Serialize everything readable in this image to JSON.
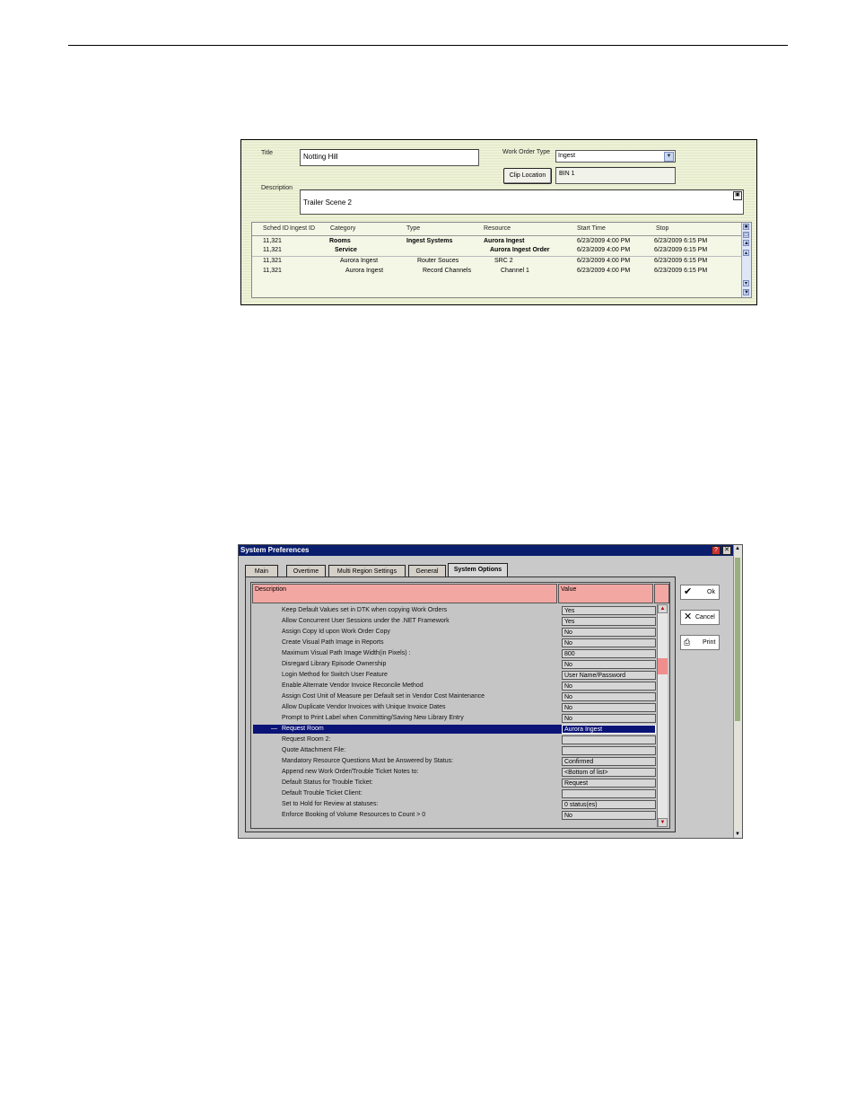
{
  "work_order": {
    "title_label": "Title",
    "title_value": "Notting Hill",
    "work_order_type_label": "Work Order Type",
    "work_order_type_value": "Ingest",
    "clip_location_button": "Clip Location",
    "clip_location_value": "BIN 1",
    "description_label": "Description",
    "description_value": "Trailer Scene 2",
    "columns": [
      "Sched ID",
      "Ingest ID",
      "Category",
      "Type",
      "Resource",
      "Start Time",
      "Stop"
    ],
    "rows": [
      {
        "sched_id": "11,321",
        "category": "Rooms",
        "type": "Ingest Systems",
        "resource": "Aurora Ingest",
        "start": "6/23/2009 4:00 PM",
        "stop": "6/23/2009 6:15 PM"
      },
      {
        "sched_id": "11,321",
        "category": "Service",
        "type": "",
        "resource": "Aurora Ingest Order",
        "start": "6/23/2009 4:00 PM",
        "stop": "6/23/2009 6:15 PM"
      },
      {
        "sched_id": "11,321",
        "category": "Aurora Ingest",
        "type": "Router Souces",
        "resource": "SRC 2",
        "start": "6/23/2009 4:00 PM",
        "stop": "6/23/2009 6:15 PM"
      },
      {
        "sched_id": "11,321",
        "category": "Aurora Ingest",
        "type": "Record Channels",
        "resource": "Channel 1",
        "start": "6/23/2009 4:00 PM",
        "stop": "6/23/2009 6:15 PM"
      }
    ]
  },
  "system_prefs": {
    "window_title": "System Preferences",
    "help_glyph": "?",
    "close_glyph": "✕",
    "tabs": [
      "Main",
      "Overtime",
      "Multi Region Settings",
      "General",
      "System Options"
    ],
    "active_tab": "System Options",
    "header_description": "Description",
    "header_value": "Value",
    "buttons": {
      "ok": "Ok",
      "cancel": "Cancel",
      "print": "Print"
    },
    "selected_marker": "—",
    "rows": [
      {
        "desc": "Keep Default Values set in DTK when copying Work Orders",
        "value": "Yes"
      },
      {
        "desc": "Allow Concurrent User Sessions under the .NET Framework",
        "value": "Yes"
      },
      {
        "desc": "Assign Copy Id upon Work Order Copy",
        "value": "No"
      },
      {
        "desc": "Create Visual Path Image in Reports",
        "value": "No"
      },
      {
        "desc": "Maximum Visual Path Image Width(in Pixels) :",
        "value": "800"
      },
      {
        "desc": "Disregard Library Episode Ownership",
        "value": "No"
      },
      {
        "desc": "Login Method for Switch User Feature",
        "value": "User Name/Password"
      },
      {
        "desc": "Enable Alternate Vendor Invoice Reconcile Method",
        "value": "No"
      },
      {
        "desc": "Assign Cost Unit of Measure per Default set in Vendor Cost Maintenance",
        "value": "No"
      },
      {
        "desc": "Allow Duplicate Vendor Invoices with Unique Invoice Dates",
        "value": "No"
      },
      {
        "desc": "Prompt to Print Label when Committing/Saving New Library Entry",
        "value": "No"
      },
      {
        "desc": "Request Room",
        "value": "Aurora Ingest"
      },
      {
        "desc": "Request Room 2:",
        "value": ""
      },
      {
        "desc": "Quote Attachment File:",
        "value": ""
      },
      {
        "desc": "Mandatory Resource Questions Must be Answered by Status:",
        "value": "Confirmed"
      },
      {
        "desc": "Append new Work Order/Trouble Ticket Notes to:",
        "value": "<Bottom of list>"
      },
      {
        "desc": "Default Status for Trouble Ticket:",
        "value": "Request"
      },
      {
        "desc": "Default Trouble Ticket Client:",
        "value": ""
      },
      {
        "desc": "Set to Hold for Review at statuses:",
        "value": "0 status(es)"
      },
      {
        "desc": "Enforce Booking of Volume Resources to Count > 0",
        "value": "No"
      }
    ],
    "selected_row": "Request Room"
  }
}
